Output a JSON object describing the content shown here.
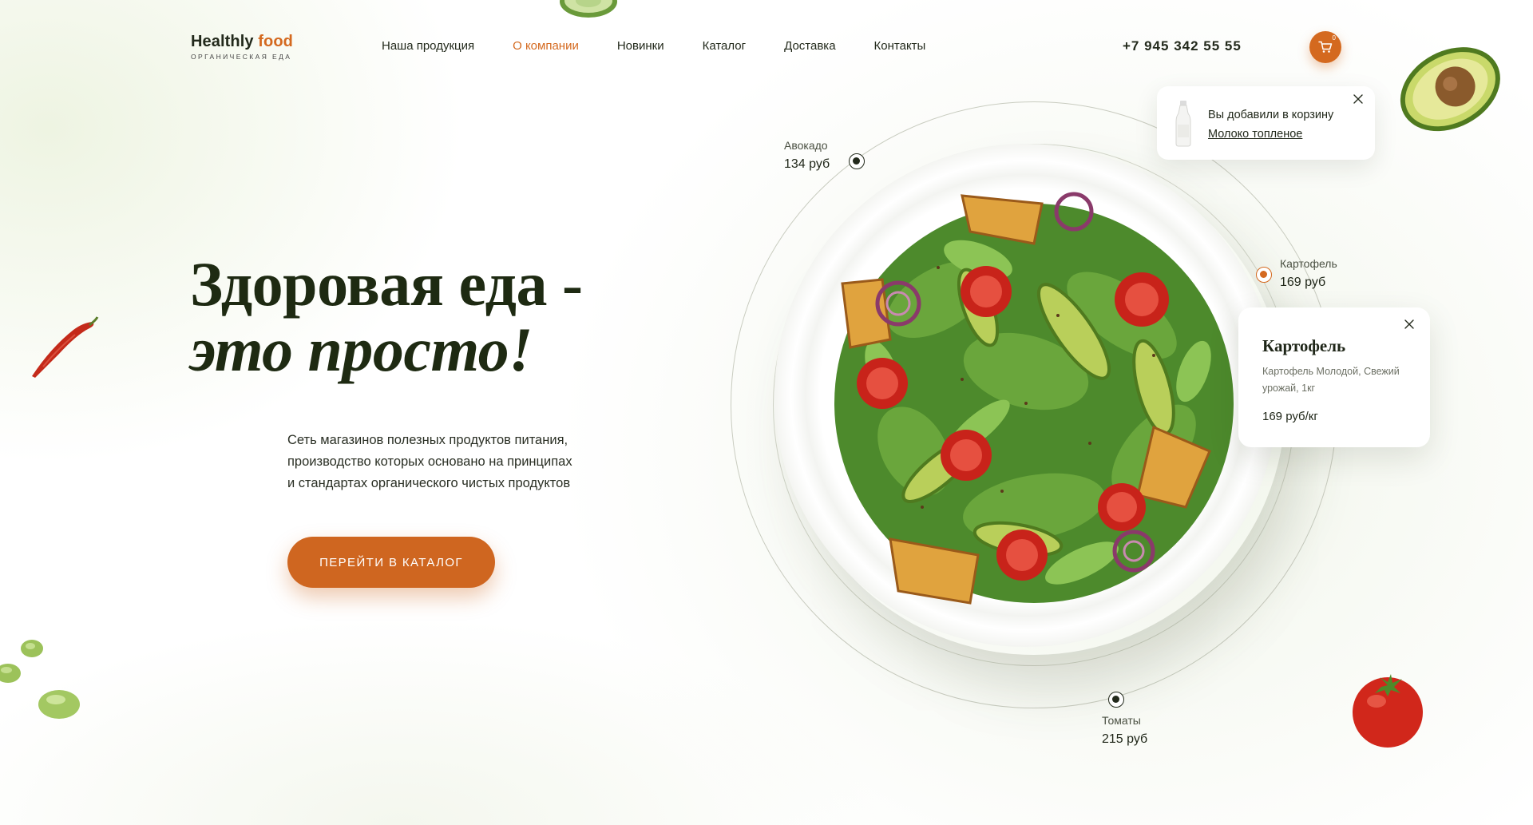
{
  "header": {
    "logo": {
      "main": "Healthly",
      "accent": "food",
      "subtitle": "ОРГАНИЧЕСКАЯ ЕДА"
    },
    "nav": [
      {
        "label": "Наша продукция",
        "active": false
      },
      {
        "label": "О компании",
        "active": true
      },
      {
        "label": "Новинки",
        "active": false
      },
      {
        "label": "Каталог",
        "active": false
      },
      {
        "label": "Доставка",
        "active": false
      },
      {
        "label": "Контакты",
        "active": false
      }
    ],
    "phone": "+7 945 342 55 55",
    "cart": {
      "icon": "cart-icon",
      "count": "0"
    }
  },
  "hero": {
    "title_line1": "Здоровая еда -",
    "title_line2": "это просто!",
    "description": [
      "Сеть магазинов полезных продуктов питания,",
      "производство которых основано на принципах",
      "и стандартах органического чистых продуктов"
    ],
    "cta_label": "ПЕРЕЙТИ В КАТАЛОГ"
  },
  "plate_points": [
    {
      "name": "Авокадо",
      "price": "134 руб",
      "active": false
    },
    {
      "name": "Картофель",
      "price": "169 руб",
      "active": true
    },
    {
      "name": "Томаты",
      "price": "215 руб",
      "active": false
    }
  ],
  "cart_toast": {
    "message": "Вы добавили в корзину",
    "product": "Молоко топленое",
    "icon": "milk-bottle-icon"
  },
  "product_card": {
    "title": "Картофель",
    "description": "Картофель Молодой, Свежий урожай, 1кг",
    "price": "169 руб/кг"
  },
  "colors": {
    "accent": "#d4691f",
    "dark": "#1e2a12",
    "text": "#22291b"
  }
}
